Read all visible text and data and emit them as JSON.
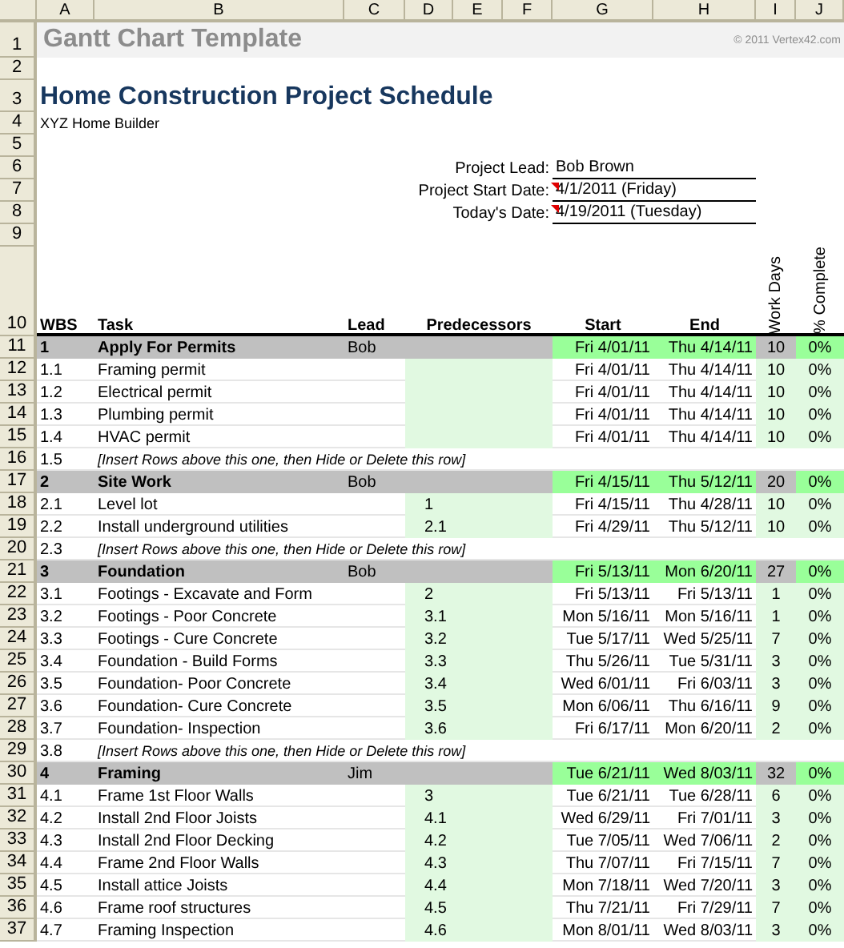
{
  "columns": [
    "A",
    "B",
    "C",
    "D",
    "E",
    "F",
    "G",
    "H",
    "I",
    "J"
  ],
  "row_numbers": [
    "1",
    "2",
    "3",
    "4",
    "5",
    "6",
    "7",
    "8",
    "9",
    "10"
  ],
  "sheet_title": "Gantt Chart Template",
  "copyright": "© 2011 Vertex42.com",
  "project_title": "Home Construction Project Schedule",
  "company": "XYZ Home Builder",
  "project_info": [
    {
      "label": "Project Lead:",
      "value": "Bob Brown",
      "comment": false
    },
    {
      "label": "Project Start Date:",
      "value": "4/1/2011 (Friday)",
      "comment": true
    },
    {
      "label": "Today's Date:",
      "value": "4/19/2011 (Tuesday)",
      "comment": true
    }
  ],
  "table": {
    "columns": {
      "wbs": "WBS",
      "task": "Task",
      "lead": "Lead",
      "predecessors": "Predecessors",
      "start": "Start",
      "end": "End",
      "work_days": "Work Days",
      "complete": "% Complete"
    },
    "rows": [
      {
        "row": "11",
        "kind": "phase",
        "wbs": "1",
        "task": "Apply For Permits",
        "lead": "Bob",
        "predecessors": "",
        "start": "Fri 4/01/11",
        "end": "Thu 4/14/11",
        "work_days": "10",
        "complete": "0%"
      },
      {
        "row": "12",
        "kind": "task",
        "wbs": "1.1",
        "task": "Framing permit",
        "lead": "",
        "predecessors": "",
        "start": "Fri 4/01/11",
        "end": "Thu 4/14/11",
        "work_days": "10",
        "complete": "0%"
      },
      {
        "row": "13",
        "kind": "task",
        "wbs": "1.2",
        "task": "Electrical permit",
        "lead": "",
        "predecessors": "",
        "start": "Fri 4/01/11",
        "end": "Thu 4/14/11",
        "work_days": "10",
        "complete": "0%"
      },
      {
        "row": "14",
        "kind": "task",
        "wbs": "1.3",
        "task": "Plumbing permit",
        "lead": "",
        "predecessors": "",
        "start": "Fri 4/01/11",
        "end": "Thu 4/14/11",
        "work_days": "10",
        "complete": "0%"
      },
      {
        "row": "15",
        "kind": "task",
        "wbs": "1.4",
        "task": "HVAC permit",
        "lead": "",
        "predecessors": "",
        "start": "Fri 4/01/11",
        "end": "Thu 4/14/11",
        "work_days": "10",
        "complete": "0%"
      },
      {
        "row": "16",
        "kind": "insert",
        "wbs": "1.5",
        "task": "[Insert Rows above this one, then Hide or Delete this row]"
      },
      {
        "row": "17",
        "kind": "phase",
        "wbs": "2",
        "task": "Site Work",
        "lead": "Bob",
        "predecessors": "",
        "start": "Fri 4/15/11",
        "end": "Thu 5/12/11",
        "work_days": "20",
        "complete": "0%"
      },
      {
        "row": "18",
        "kind": "task",
        "wbs": "2.1",
        "task": "Level lot",
        "lead": "",
        "predecessors": "1",
        "start": "Fri 4/15/11",
        "end": "Thu 4/28/11",
        "work_days": "10",
        "complete": "0%"
      },
      {
        "row": "19",
        "kind": "task",
        "wbs": "2.2",
        "task": "Install underground utilities",
        "lead": "",
        "predecessors": "2.1",
        "start": "Fri 4/29/11",
        "end": "Thu 5/12/11",
        "work_days": "10",
        "complete": "0%"
      },
      {
        "row": "20",
        "kind": "insert",
        "wbs": "2.3",
        "task": "[Insert Rows above this one, then Hide or Delete this row]"
      },
      {
        "row": "21",
        "kind": "phase",
        "wbs": "3",
        "task": "Foundation",
        "lead": "Bob",
        "predecessors": "",
        "start": "Fri 5/13/11",
        "end": "Mon 6/20/11",
        "work_days": "27",
        "complete": "0%"
      },
      {
        "row": "22",
        "kind": "task",
        "wbs": "3.1",
        "task": "Footings - Excavate and Form",
        "lead": "",
        "predecessors": "2",
        "start": "Fri 5/13/11",
        "end": "Fri 5/13/11",
        "work_days": "1",
        "complete": "0%"
      },
      {
        "row": "23",
        "kind": "task",
        "wbs": "3.2",
        "task": "Footings - Poor Concrete",
        "lead": "",
        "predecessors": "3.1",
        "start": "Mon 5/16/11",
        "end": "Mon 5/16/11",
        "work_days": "1",
        "complete": "0%"
      },
      {
        "row": "24",
        "kind": "task",
        "wbs": "3.3",
        "task": "Footings - Cure Concrete",
        "lead": "",
        "predecessors": "3.2",
        "start": "Tue 5/17/11",
        "end": "Wed 5/25/11",
        "work_days": "7",
        "complete": "0%"
      },
      {
        "row": "25",
        "kind": "task",
        "wbs": "3.4",
        "task": "Foundation - Build Forms",
        "lead": "",
        "predecessors": "3.3",
        "start": "Thu 5/26/11",
        "end": "Tue 5/31/11",
        "work_days": "3",
        "complete": "0%"
      },
      {
        "row": "26",
        "kind": "task",
        "wbs": "3.5",
        "task": "Foundation- Poor Concrete",
        "lead": "",
        "predecessors": "3.4",
        "start": "Wed 6/01/11",
        "end": "Fri 6/03/11",
        "work_days": "3",
        "complete": "0%"
      },
      {
        "row": "27",
        "kind": "task",
        "wbs": "3.6",
        "task": "Foundation- Cure Concrete",
        "lead": "",
        "predecessors": "3.5",
        "start": "Mon 6/06/11",
        "end": "Thu 6/16/11",
        "work_days": "9",
        "complete": "0%"
      },
      {
        "row": "28",
        "kind": "task",
        "wbs": "3.7",
        "task": "Foundation- Inspection",
        "lead": "",
        "predecessors": "3.6",
        "start": "Fri 6/17/11",
        "end": "Mon 6/20/11",
        "work_days": "2",
        "complete": "0%"
      },
      {
        "row": "29",
        "kind": "insert",
        "wbs": "3.8",
        "task": "[Insert Rows above this one, then Hide or Delete this row]"
      },
      {
        "row": "30",
        "kind": "phase",
        "wbs": "4",
        "task": "Framing",
        "lead": "Jim",
        "predecessors": "",
        "start": "Tue 6/21/11",
        "end": "Wed 8/03/11",
        "work_days": "32",
        "complete": "0%"
      },
      {
        "row": "31",
        "kind": "task",
        "wbs": "4.1",
        "task": "Frame 1st Floor Walls",
        "lead": "",
        "predecessors": "3",
        "start": "Tue 6/21/11",
        "end": "Tue 6/28/11",
        "work_days": "6",
        "complete": "0%"
      },
      {
        "row": "32",
        "kind": "task",
        "wbs": "4.2",
        "task": "Install 2nd Floor Joists",
        "lead": "",
        "predecessors": "4.1",
        "start": "Wed 6/29/11",
        "end": "Fri 7/01/11",
        "work_days": "3",
        "complete": "0%"
      },
      {
        "row": "33",
        "kind": "task",
        "wbs": "4.3",
        "task": "Install 2nd Floor Decking",
        "lead": "",
        "predecessors": "4.2",
        "start": "Tue 7/05/11",
        "end": "Wed 7/06/11",
        "work_days": "2",
        "complete": "0%"
      },
      {
        "row": "34",
        "kind": "task",
        "wbs": "4.4",
        "task": "Frame 2nd Floor Walls",
        "lead": "",
        "predecessors": "4.3",
        "start": "Thu 7/07/11",
        "end": "Fri 7/15/11",
        "work_days": "7",
        "complete": "0%"
      },
      {
        "row": "35",
        "kind": "task",
        "wbs": "4.5",
        "task": "Install attice Joists",
        "lead": "",
        "predecessors": "4.4",
        "start": "Mon 7/18/11",
        "end": "Wed 7/20/11",
        "work_days": "3",
        "complete": "0%"
      },
      {
        "row": "36",
        "kind": "task",
        "wbs": "4.6",
        "task": "Frame roof structures",
        "lead": "",
        "predecessors": "4.5",
        "start": "Thu 7/21/11",
        "end": "Fri 7/29/11",
        "work_days": "7",
        "complete": "0%"
      },
      {
        "row": "37",
        "kind": "task",
        "wbs": "4.7",
        "task": "Framing Inspection",
        "lead": "",
        "predecessors": "4.6",
        "start": "Mon 8/01/11",
        "end": "Wed 8/03/11",
        "work_days": "3",
        "complete": "0%"
      }
    ]
  }
}
